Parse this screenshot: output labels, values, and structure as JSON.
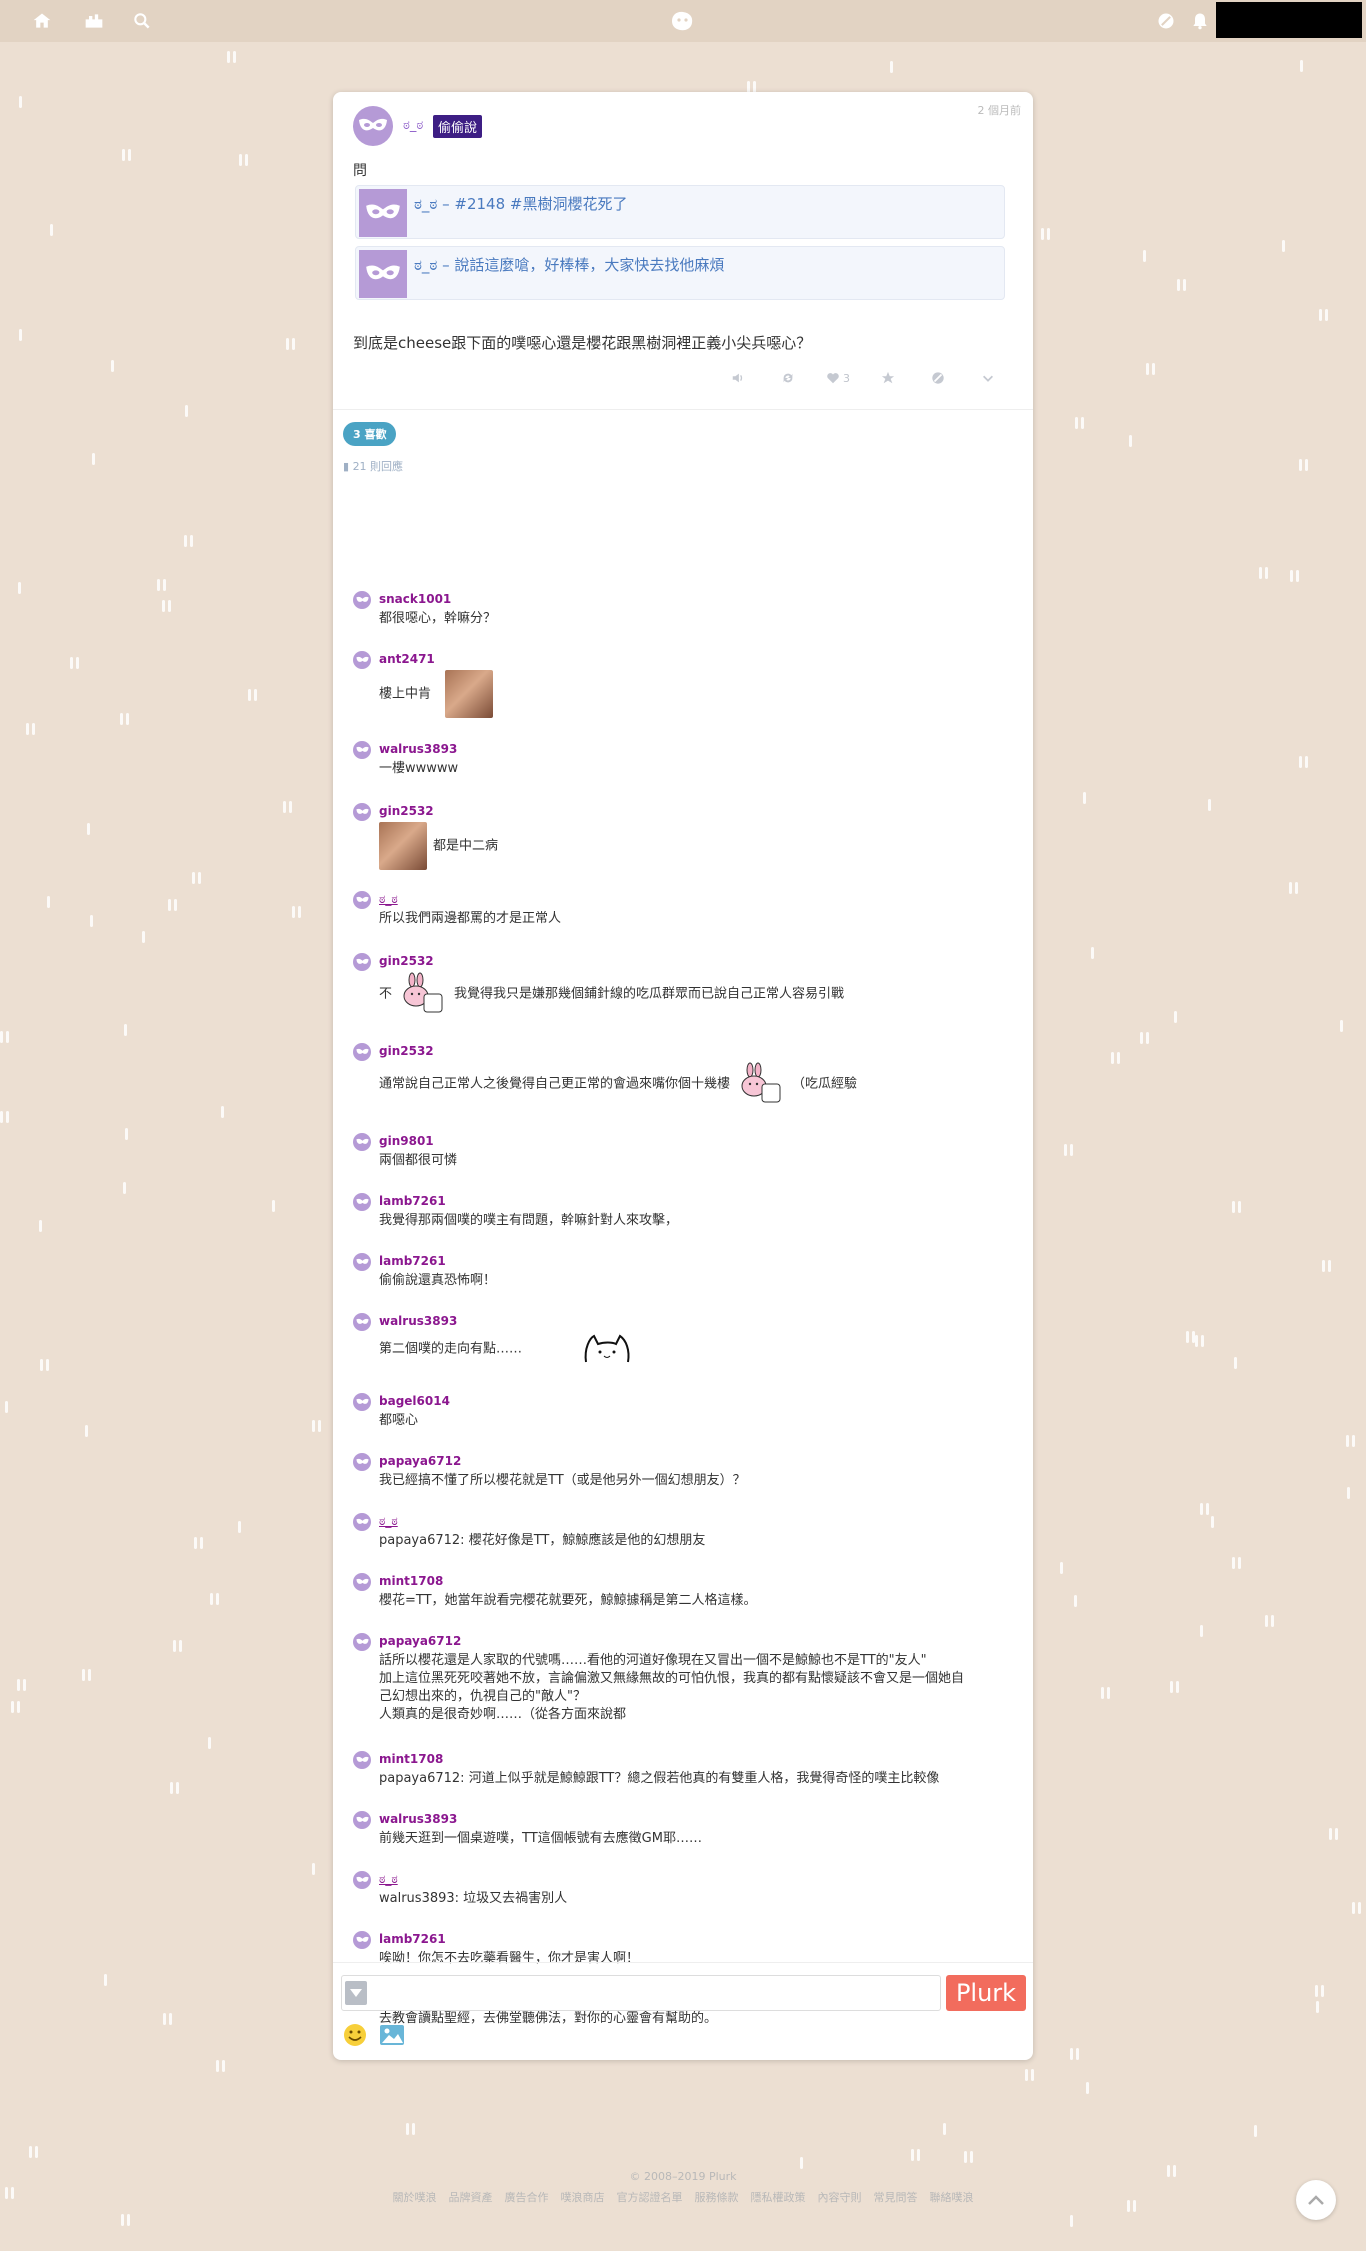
{
  "topbar": {
    "icons": [
      "home-icon",
      "timeline-icon",
      "search-icon",
      "logo-icon",
      "settings-icon",
      "notification-icon"
    ]
  },
  "post": {
    "author": "ಠ_ಠ",
    "qualifier": "偷偷說",
    "time": "2 個月前",
    "question": "問",
    "quotes": [
      {
        "text": "ಠ_ಠ – #2148 #黑樹洞櫻花死了"
      },
      {
        "text": "ಠ_ಠ – 說話這麼嗆，好棒棒，大家快去找他麻煩"
      }
    ],
    "content": "到底是cheese跟下面的噗噁心還是櫻花跟黑樹洞裡正義小尖兵噁心？",
    "like_count": "3"
  },
  "likes_badge": "3 喜歡",
  "response_count": "21 則回應",
  "responses": [
    {
      "name": "snack1001",
      "text": "都很噁心，幹嘛分？"
    },
    {
      "name": "ant2471",
      "text": "樓上中肯"
    },
    {
      "name": "walrus3893",
      "text": "一樓wwwww"
    },
    {
      "name": "gin2532",
      "text": "都是中二病"
    },
    {
      "name": "ಠ_ಠ",
      "text": "所以我們兩邊都罵的才是正常人"
    },
    {
      "name": "gin2532",
      "text_a": "不",
      "text_b": "我覺得我只是嫌那幾個鋪針線的吃瓜群眾而已說自己正常人容易引戰"
    },
    {
      "name": "gin2532",
      "text_a": "通常說自己正常人之後覺得自己更正常的會過來嘴你個十幾樓",
      "text_b": "（吃瓜經驗"
    },
    {
      "name": "gin9801",
      "text": "兩個都很可憐"
    },
    {
      "name": "lamb7261",
      "text": "我覺得那兩個噗的噗主有問題，幹嘛針對人來攻擊，"
    },
    {
      "name": "lamb7261",
      "text": "偷偷說還真恐怖啊！"
    },
    {
      "name": "walrus3893",
      "text": "第二個噗的走向有點……"
    },
    {
      "name": "bagel6014",
      "text": "都噁心"
    },
    {
      "name": "papaya6712",
      "text": "我已經搞不懂了所以櫻花就是TT（或是他另外一個幻想朋友）？"
    },
    {
      "name": "ಠ_ಠ",
      "text": "papaya6712: 櫻花好像是TT，鯨鯨應該是他的幻想朋友"
    },
    {
      "name": "mint1708",
      "text": "櫻花=TT，她當年說看完櫻花就要死，鯨鯨據稱是第二人格這樣。"
    },
    {
      "name": "papaya6712",
      "text_lines": [
        "話所以櫻花還是人家取的代號嗎……看他的河道好像現在又冒出一個不是鯨鯨也不是TT的\"友人\"",
        "加上這位黑死死咬著她不放，言論偏激又無緣無故的可怕仇恨，我真的都有點懷疑該不會又是一個她自",
        "己幻想出來的，仇視自己的\"敵人\"？",
        "人類真的是很奇妙啊……（從各方面來說都"
      ]
    },
    {
      "name": "mint1708",
      "text": "papaya6712: 河道上似乎就是鯨鯨跟TT？總之假若他真的有雙重人格，我覺得奇怪的噗主比較像"
    },
    {
      "name": "walrus3893",
      "text": "前幾天逛到一個桌遊噗，TT這個帳號有去應徵GM耶……"
    },
    {
      "name": "ಠ_ಠ",
      "text": "walrus3893: 垃圾又去禍害別人"
    },
    {
      "name": "lamb7261",
      "text": "唉呦！你怎不去吃藥看醫生，你才是害人啊！"
    },
    {
      "name": "lamb7261",
      "text": "去教會讀點聖經，去佛堂聽佛法，對你的心靈會有幫助的。"
    }
  ],
  "composer": {
    "placeholder": "",
    "submit_label": "Plurk"
  },
  "footer": {
    "copyright": "© 2008–2019 Plurk",
    "links": [
      "關於噗浪",
      "品牌資產",
      "廣告合作",
      "噗浪商店",
      "官方認證名單",
      "服務條款",
      "隱私權政策",
      "內容守則",
      "常見問答",
      "聯絡噗浪"
    ]
  }
}
